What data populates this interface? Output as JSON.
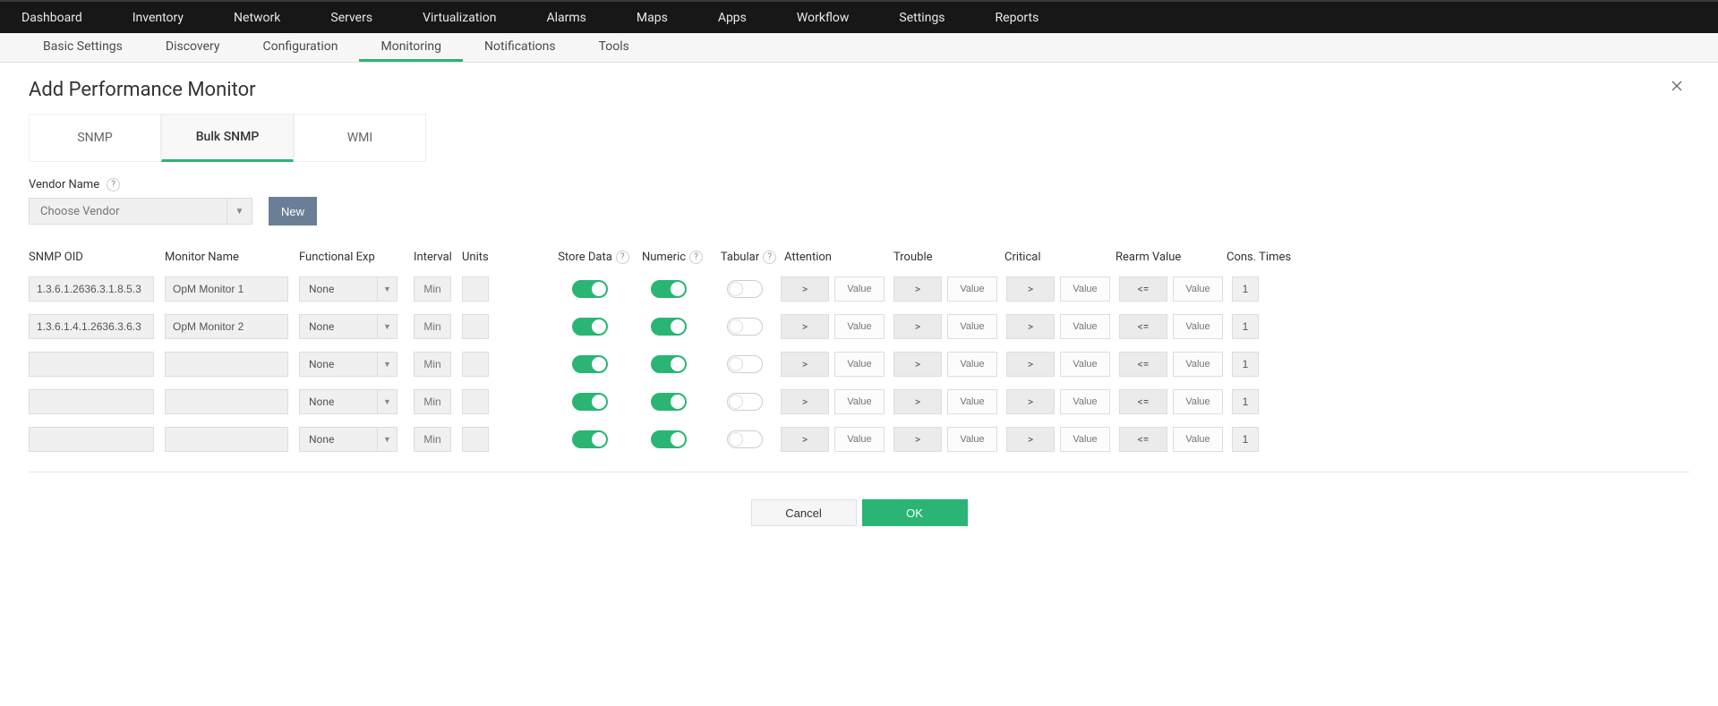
{
  "topNav": [
    "Dashboard",
    "Inventory",
    "Network",
    "Servers",
    "Virtualization",
    "Alarms",
    "Maps",
    "Apps",
    "Workflow",
    "Settings",
    "Reports"
  ],
  "subNav": {
    "items": [
      "Basic Settings",
      "Discovery",
      "Configuration",
      "Monitoring",
      "Notifications",
      "Tools"
    ],
    "active": "Monitoring"
  },
  "page": {
    "title": "Add Performance Monitor"
  },
  "tabs": {
    "items": [
      "SNMP",
      "Bulk SNMP",
      "WMI"
    ],
    "active": "Bulk SNMP"
  },
  "vendor": {
    "label": "Vendor Name",
    "placeholder": "Choose Vendor",
    "newButton": "New"
  },
  "columns": {
    "oid": "SNMP OID",
    "name": "Monitor Name",
    "func": "Functional Exp",
    "interval": "Interval",
    "units": "Units",
    "store": "Store Data",
    "numeric": "Numeric",
    "tabular": "Tabular",
    "attention": "Attention",
    "trouble": "Trouble",
    "critical": "Critical",
    "rearm": "Rearm Value",
    "cons": "Cons. Times"
  },
  "defaults": {
    "funcNone": "None",
    "intervalPlaceholder": "Min",
    "valuePlaceholder": "Value",
    "opGt": ">",
    "opLte": "<=",
    "consDefault": "1"
  },
  "rows": [
    {
      "oid": "1.3.6.1.2636.3.1.8.5.3",
      "name": "OpM Monitor 1",
      "func": "None",
      "interval": "Min",
      "units": "",
      "store": true,
      "numeric": true,
      "tabular": false,
      "attentionOp": ">",
      "attentionVal": "",
      "troubleOp": ">",
      "troubleVal": "",
      "criticalOp": ">",
      "criticalVal": "",
      "rearmOp": "<=",
      "rearmVal": "",
      "cons": "1"
    },
    {
      "oid": "1.3.6.1.4.1.2636.3.6.3",
      "name": "OpM Monitor 2",
      "func": "None",
      "interval": "Min",
      "units": "",
      "store": true,
      "numeric": true,
      "tabular": false,
      "attentionOp": ">",
      "attentionVal": "",
      "troubleOp": ">",
      "troubleVal": "",
      "criticalOp": ">",
      "criticalVal": "",
      "rearmOp": "<=",
      "rearmVal": "",
      "cons": "1"
    },
    {
      "oid": "",
      "name": "",
      "func": "None",
      "interval": "Min",
      "units": "",
      "store": true,
      "numeric": true,
      "tabular": false,
      "attentionOp": ">",
      "attentionVal": "",
      "troubleOp": ">",
      "troubleVal": "",
      "criticalOp": ">",
      "criticalVal": "",
      "rearmOp": "<=",
      "rearmVal": "",
      "cons": "1"
    },
    {
      "oid": "",
      "name": "",
      "func": "None",
      "interval": "Min",
      "units": "",
      "store": true,
      "numeric": true,
      "tabular": false,
      "attentionOp": ">",
      "attentionVal": "",
      "troubleOp": ">",
      "troubleVal": "",
      "criticalOp": ">",
      "criticalVal": "",
      "rearmOp": "<=",
      "rearmVal": "",
      "cons": "1"
    },
    {
      "oid": "",
      "name": "",
      "func": "None",
      "interval": "Min",
      "units": "",
      "store": true,
      "numeric": true,
      "tabular": false,
      "attentionOp": ">",
      "attentionVal": "",
      "troubleOp": ">",
      "troubleVal": "",
      "criticalOp": ">",
      "criticalVal": "",
      "rearmOp": "<=",
      "rearmVal": "",
      "cons": "1"
    }
  ],
  "actions": {
    "cancel": "Cancel",
    "ok": "OK"
  }
}
